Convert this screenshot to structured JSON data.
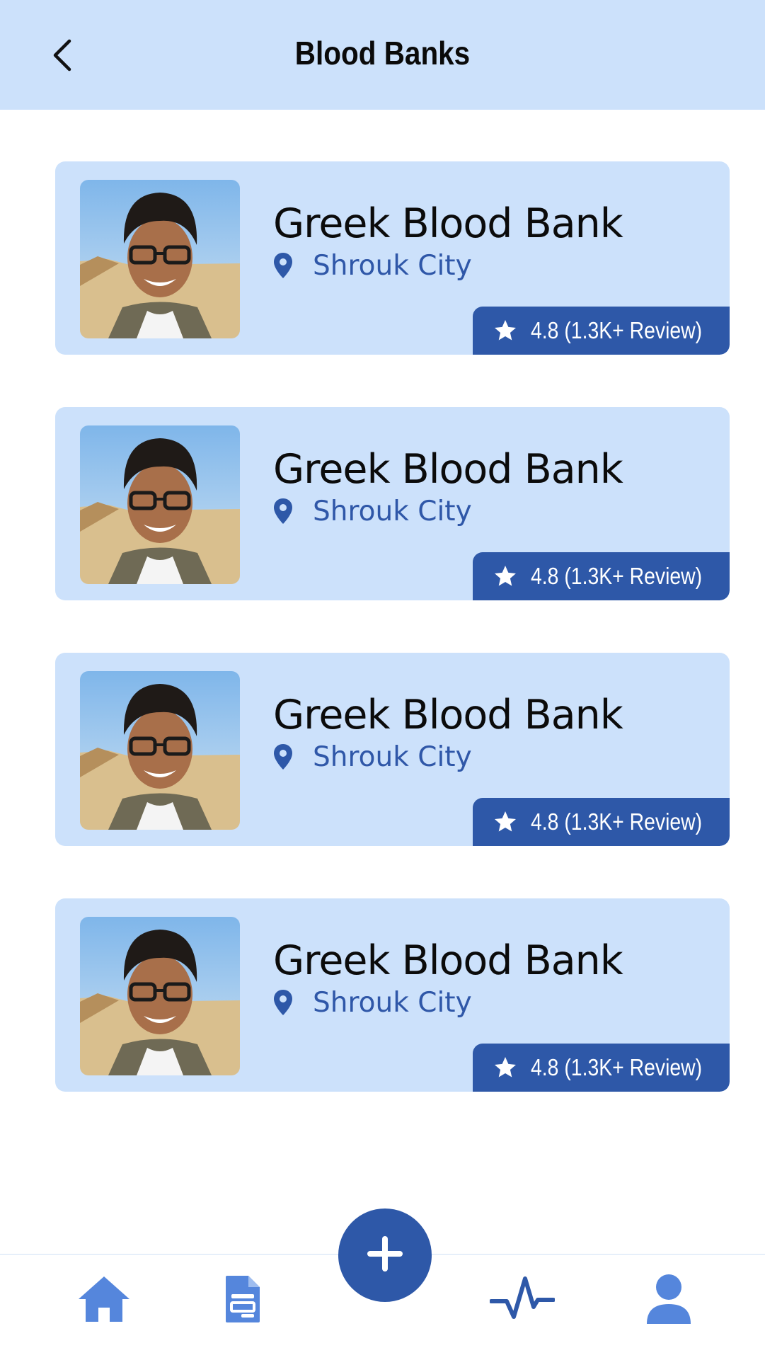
{
  "header": {
    "title": "Blood Banks",
    "back_icon": "chevron-left-icon"
  },
  "banks": [
    {
      "name": "Greek Blood Bank",
      "location": "Shrouk City",
      "rating": "4.8 (1.3K+ Review)"
    },
    {
      "name": "Greek Blood Bank",
      "location": "Shrouk City",
      "rating": "4.8 (1.3K+ Review)"
    },
    {
      "name": "Greek Blood Bank",
      "location": "Shrouk City",
      "rating": "4.8 (1.3K+ Review)"
    },
    {
      "name": "Greek Blood Bank",
      "location": "Shrouk City",
      "rating": "4.8 (1.3K+ Review)"
    }
  ],
  "bottom_nav": {
    "items": [
      "home-icon",
      "document-icon",
      "add-icon",
      "activity-icon",
      "profile-icon"
    ]
  },
  "colors": {
    "header_bg": "#cce1fb",
    "card_bg": "#cce1fb",
    "accent": "#2e58a8",
    "nav_icon": "#5586dc",
    "title_text": "#0a0a0a"
  }
}
